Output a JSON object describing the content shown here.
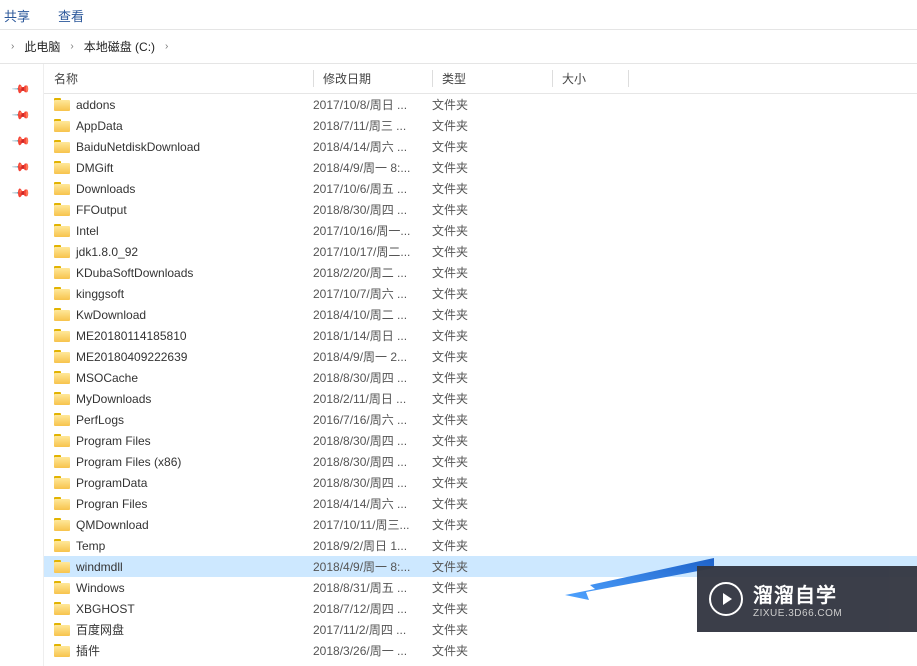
{
  "menu": {
    "share": "共享",
    "view": "查看"
  },
  "breadcrumb": {
    "this_pc": "此电脑",
    "drive": "本地磁盘 (C:)"
  },
  "columns": {
    "name": "名称",
    "date": "修改日期",
    "type": "类型",
    "size": "大小"
  },
  "folder_type_label": "文件夹",
  "selected_index": 22,
  "files": [
    {
      "name": "addons",
      "date": "2017/10/8/周日 ...",
      "type": "文件夹"
    },
    {
      "name": "AppData",
      "date": "2018/7/11/周三 ...",
      "type": "文件夹"
    },
    {
      "name": "BaiduNetdiskDownload",
      "date": "2018/4/14/周六 ...",
      "type": "文件夹"
    },
    {
      "name": "DMGift",
      "date": "2018/4/9/周一 8:...",
      "type": "文件夹"
    },
    {
      "name": "Downloads",
      "date": "2017/10/6/周五 ...",
      "type": "文件夹"
    },
    {
      "name": "FFOutput",
      "date": "2018/8/30/周四 ...",
      "type": "文件夹"
    },
    {
      "name": "Intel",
      "date": "2017/10/16/周一...",
      "type": "文件夹"
    },
    {
      "name": "jdk1.8.0_92",
      "date": "2017/10/17/周二...",
      "type": "文件夹"
    },
    {
      "name": "KDubaSoftDownloads",
      "date": "2018/2/20/周二 ...",
      "type": "文件夹"
    },
    {
      "name": "kinggsoft",
      "date": "2017/10/7/周六 ...",
      "type": "文件夹"
    },
    {
      "name": "KwDownload",
      "date": "2018/4/10/周二 ...",
      "type": "文件夹"
    },
    {
      "name": "ME20180114185810",
      "date": "2018/1/14/周日 ...",
      "type": "文件夹"
    },
    {
      "name": "ME20180409222639",
      "date": "2018/4/9/周一 2...",
      "type": "文件夹"
    },
    {
      "name": "MSOCache",
      "date": "2018/8/30/周四 ...",
      "type": "文件夹"
    },
    {
      "name": "MyDownloads",
      "date": "2018/2/11/周日 ...",
      "type": "文件夹"
    },
    {
      "name": "PerfLogs",
      "date": "2016/7/16/周六 ...",
      "type": "文件夹"
    },
    {
      "name": "Program Files",
      "date": "2018/8/30/周四 ...",
      "type": "文件夹"
    },
    {
      "name": "Program Files (x86)",
      "date": "2018/8/30/周四 ...",
      "type": "文件夹"
    },
    {
      "name": "ProgramData",
      "date": "2018/8/30/周四 ...",
      "type": "文件夹"
    },
    {
      "name": "Progran Files",
      "date": "2018/4/14/周六 ...",
      "type": "文件夹"
    },
    {
      "name": "QMDownload",
      "date": "2017/10/11/周三...",
      "type": "文件夹"
    },
    {
      "name": "Temp",
      "date": "2018/9/2/周日 1...",
      "type": "文件夹"
    },
    {
      "name": "windmdll",
      "date": "2018/4/9/周一 8:...",
      "type": "文件夹"
    },
    {
      "name": "Windows",
      "date": "2018/8/31/周五 ...",
      "type": "文件夹"
    },
    {
      "name": "XBGHOST",
      "date": "2018/7/12/周四 ...",
      "type": "文件夹"
    },
    {
      "name": "百度网盘",
      "date": "2017/11/2/周四 ...",
      "type": "文件夹"
    },
    {
      "name": "插件",
      "date": "2018/3/26/周一 ...",
      "type": "文件夹"
    }
  ],
  "watermark": {
    "title": "溜溜自学",
    "url": "ZIXUE.3D66.COM"
  }
}
